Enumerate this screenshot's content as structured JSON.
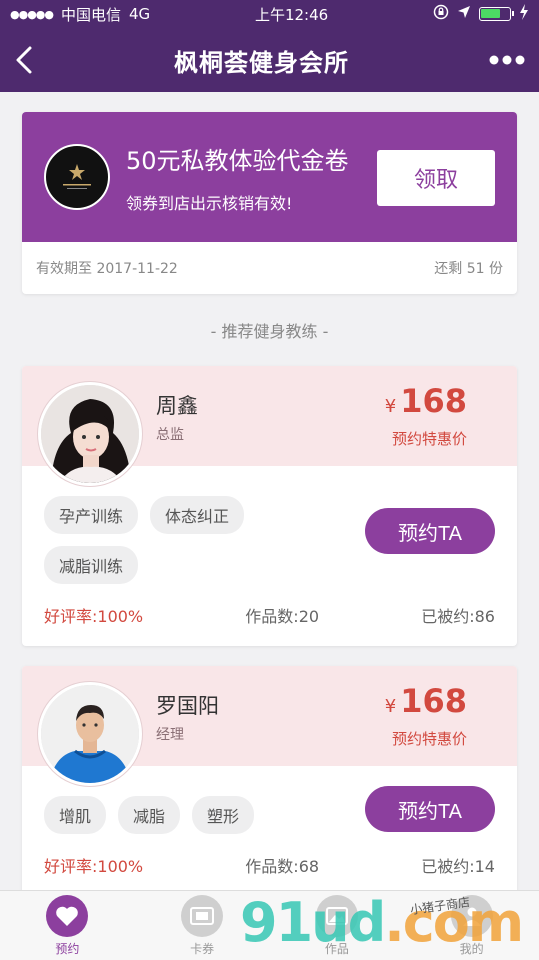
{
  "status_bar": {
    "carrier": "中国电信",
    "network": "4G",
    "time": "上午12:46",
    "battery_level": 0.7
  },
  "header": {
    "title": "枫桐荟健身会所"
  },
  "coupon": {
    "title": "50元私教体验代金卷",
    "subtitle": "领券到店出示核销有效!",
    "claim_label": "领取",
    "validity": "有效期至 2017-11-22",
    "remaining": "还剩 51 份"
  },
  "section_title": "- 推荐健身教练 -",
  "coaches": [
    {
      "name": "周鑫",
      "role": "总监",
      "currency": "¥",
      "price": "168",
      "price_label": "预约特惠价",
      "tags": [
        "孕产训练",
        "体态纠正",
        "减脂训练"
      ],
      "book_label": "预约TA",
      "rating": "好评率:100%",
      "works": "作品数:20",
      "booked": "已被约:86"
    },
    {
      "name": "罗国阳",
      "role": "经理",
      "currency": "¥",
      "price": "168",
      "price_label": "预约特惠价",
      "tags": [
        "增肌",
        "减脂",
        "塑形"
      ],
      "book_label": "预约TA",
      "rating": "好评率:100%",
      "works": "作品数:68",
      "booked": "已被约:14"
    }
  ],
  "tabbar": {
    "items": [
      {
        "label": "预约",
        "icon": "heart-icon",
        "active": true
      },
      {
        "label": "卡券",
        "icon": "card-icon",
        "active": false
      },
      {
        "label": "作品",
        "icon": "image-icon",
        "active": false
      },
      {
        "label": "我的",
        "icon": "user-icon",
        "active": false
      }
    ]
  },
  "watermark": {
    "text": "91ud",
    "suffix": ".com",
    "note": "小猪子商店"
  },
  "colors": {
    "header_bg": "#4e2a6e",
    "accent": "#8c3f9e",
    "price": "#d2493f",
    "card_head_bg": "#f9e6e8"
  }
}
